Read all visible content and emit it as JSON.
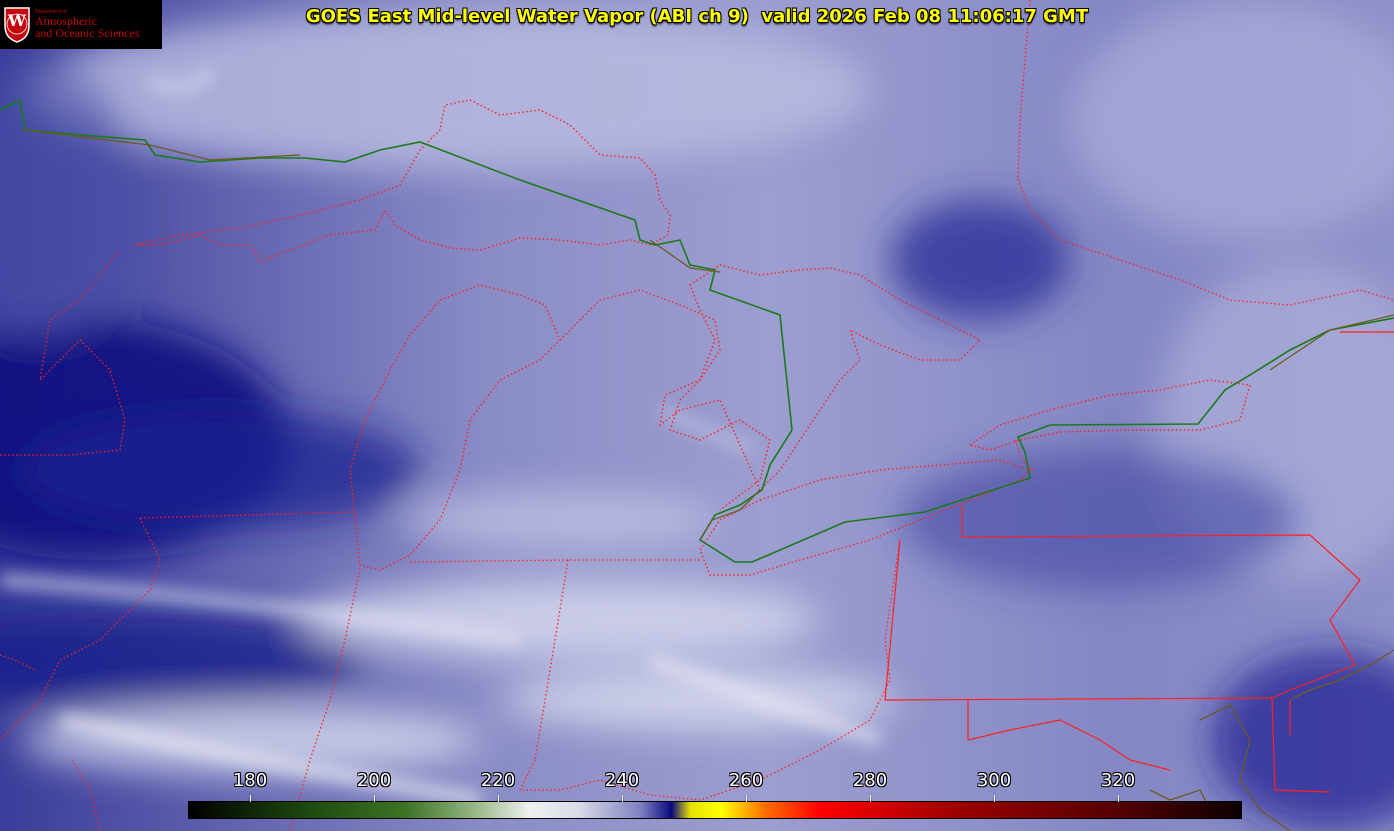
{
  "title": "GOES East Mid-level Water Vapor (ABI ch 9)  valid 2026 Feb 08 11:06:17 GMT",
  "logo": {
    "small_text": "Department of",
    "line1": "Atmospheric",
    "line2": "and Oceanic Sciences",
    "shield_letter": "W",
    "shield_color": "#c5050c"
  },
  "colorbar": {
    "min": 170,
    "max": 340,
    "ticks": [
      {
        "value": 180,
        "label": "180"
      },
      {
        "value": 200,
        "label": "200"
      },
      {
        "value": 220,
        "label": "220"
      },
      {
        "value": 240,
        "label": "240"
      },
      {
        "value": 260,
        "label": "260"
      },
      {
        "value": 280,
        "label": "280"
      },
      {
        "value": 300,
        "label": "300"
      },
      {
        "value": 320,
        "label": "320"
      }
    ],
    "stops": [
      {
        "value": 170,
        "color": "#000000"
      },
      {
        "value": 190,
        "color": "#1e4c10"
      },
      {
        "value": 205,
        "color": "#3c7424"
      },
      {
        "value": 215,
        "color": "#8cb07a"
      },
      {
        "value": 225,
        "color": "#eef0ee"
      },
      {
        "value": 233,
        "color": "#d8dae8"
      },
      {
        "value": 243,
        "color": "#7e80c0"
      },
      {
        "value": 248,
        "color": "#0a0a80"
      },
      {
        "value": 251,
        "color": "#e6e000"
      },
      {
        "value": 256,
        "color": "#ffff00"
      },
      {
        "value": 263,
        "color": "#ff7000"
      },
      {
        "value": 272,
        "color": "#ff0000"
      },
      {
        "value": 295,
        "color": "#990000"
      },
      {
        "value": 320,
        "color": "#550000"
      },
      {
        "value": 340,
        "color": "#0c0000"
      }
    ]
  },
  "map_colors": {
    "state_border": "#ff2020",
    "international_border": "#1a7a1a",
    "coastline": "#6b5a24"
  }
}
